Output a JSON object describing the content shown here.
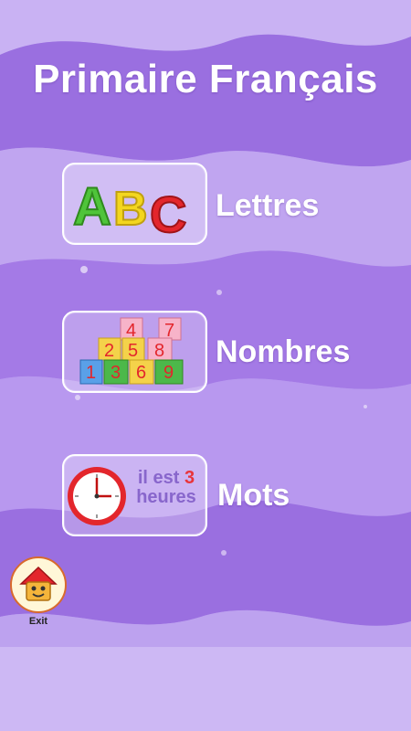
{
  "app": {
    "title": "Primaire Français"
  },
  "menu": {
    "letters": {
      "label": "Lettres",
      "icon": "abc-letters-icon",
      "icon_text": [
        "A",
        "B",
        "C"
      ]
    },
    "numbers": {
      "label": "Nombres",
      "icon": "number-blocks-icon",
      "icon_text": [
        "4",
        "7",
        "2",
        "5",
        "8",
        "1",
        "3",
        "6",
        "9"
      ]
    },
    "words": {
      "label": "Mots",
      "icon": "clock-icon",
      "line1_text": "il est",
      "line1_number": "3",
      "line2_text": "heures"
    }
  },
  "exit": {
    "label": "Exit",
    "icon": "house-face-icon"
  },
  "colors": {
    "background": "#a982e6",
    "wave_light": "#c7b0f2",
    "wave_dark": "#8f62dc",
    "text": "#ffffff"
  }
}
